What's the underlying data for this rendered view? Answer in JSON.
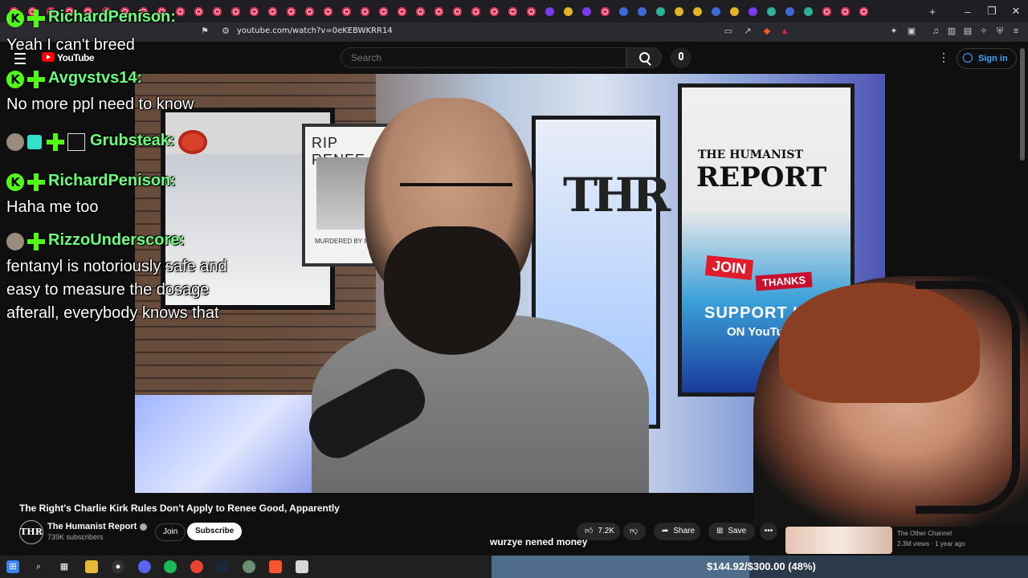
{
  "browser": {
    "url": "youtube.com/watch?v=0eKEBWKRR14"
  },
  "youtube": {
    "logo_text": "YouTube",
    "search_placeholder": "Search",
    "sign_in_label": "Sign in"
  },
  "chat": [
    {
      "user": "RichardPenison:",
      "message": "Yeah I can't breed",
      "badges": [
        "kick-badge",
        "plus-badge"
      ]
    },
    {
      "user": "Avgvstvs14:",
      "message": "No more ppl need to know",
      "badges": [
        "kick-badge",
        "plus-badge"
      ]
    },
    {
      "user": "Grubsteak:",
      "message": "",
      "badges": [
        "avatar-badge",
        "gift-badge",
        "plus-badge",
        "box-badge"
      ]
    },
    {
      "user": "RichardPenison:",
      "message": "Haha me too",
      "badges": [
        "kick-badge",
        "plus-badge"
      ]
    },
    {
      "user": "RizzoUnderscore:",
      "message": "fentanyl is notoriously safe and",
      "message2": "easy to measure the dosage",
      "message3": "afterall, everybody knows that",
      "badges": [
        "avatar-badge",
        "plus-badge"
      ]
    }
  ],
  "video": {
    "title": "The Right's Charlie Kirk Rules Don't Apply to Renee Good, Apparently",
    "poster_title": "RIP RENEE",
    "poster_caption": "MURDERED BY ICE",
    "monitor_logo": "THR",
    "monitor_the_humanist": "THE HUMANIST",
    "monitor_report": "REPORT",
    "join_badge": "JOIN",
    "thanks_badge": "THANKS",
    "support_text": "SUPPORT US",
    "on_youtube": "ON YouTube"
  },
  "channel": {
    "avatar_text": "THR",
    "name": "The Humanist Report",
    "subscribers": "739K subscribers",
    "join_label": "Join",
    "subscribe_label": "Subscribe"
  },
  "actions": {
    "likes": "7.2K",
    "share": "Share",
    "save": "Save",
    "more": "•••"
  },
  "caption": "wurzye nened money",
  "recommendation": {
    "channel": "The Other Channel",
    "meta": "2.3M views · 1 year ago"
  },
  "goal": {
    "text": "$144.92/$300.00 (48%)",
    "fraction": 0.48
  },
  "taskbar": {
    "icons": [
      "windows-icon",
      "search-icon",
      "taskview-icon",
      "folder-icon",
      "obs-icon",
      "discord-icon",
      "spotify-icon",
      "chrome-icon",
      "steam-icon",
      "app-icon",
      "brave-icon",
      "streamer-icon"
    ]
  }
}
